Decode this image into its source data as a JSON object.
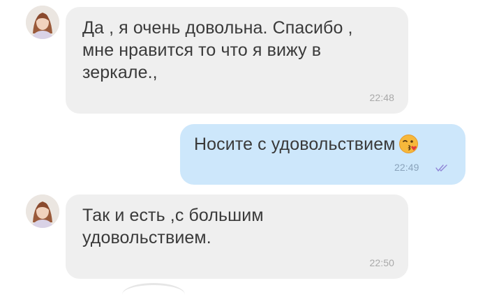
{
  "messages": [
    {
      "direction": "incoming",
      "lines": [
        "Да  , я очень довольна. Спасибо ,",
        "мне нравится то что я вижу в",
        "зеркале.,"
      ],
      "time": "22:48"
    },
    {
      "direction": "outgoing",
      "lines": [
        "Носите с удовольствием"
      ],
      "emoji": "kissing-face-emoji",
      "time": "22:49",
      "status": "read-double-check"
    },
    {
      "direction": "incoming",
      "lines": [
        "Так и есть ,с большим",
        "удовольствием."
      ],
      "time": "22:50"
    }
  ],
  "colors": {
    "incoming_bubble": "#efefef",
    "outgoing_bubble": "#cde7fb",
    "text": "#3a3a3a",
    "time": "#a9a9a9",
    "read_ticks": "#8f84d6"
  }
}
